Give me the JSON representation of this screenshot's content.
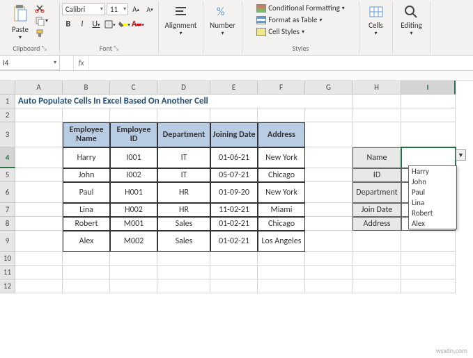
{
  "ribbon": {
    "clipboard": {
      "paste": "Paste",
      "label": "Clipboard"
    },
    "font": {
      "name": "Calibri",
      "size": "11",
      "bold": "B",
      "italic": "I",
      "underline": "U",
      "label": "Font"
    },
    "alignment": {
      "btn": "Alignment",
      "label": "Alignment"
    },
    "number": {
      "btn": "Number",
      "label": "Number"
    },
    "styles": {
      "cond": "Conditional Formatting",
      "table": "Format as Table",
      "cell": "Cell Styles",
      "label": "Styles"
    },
    "cells": {
      "btn": "Cells",
      "label": "Cells"
    },
    "editing": {
      "btn": "Editing",
      "label": "Editing"
    }
  },
  "namebox": "I4",
  "formula": "",
  "columns": [
    "A",
    "B",
    "C",
    "D",
    "E",
    "F",
    "G",
    "H",
    "I"
  ],
  "rows": [
    "1",
    "2",
    "3",
    "4",
    "5",
    "6",
    "7",
    "8",
    "9",
    "10",
    "11",
    "12"
  ],
  "title": "Auto Populate Cells In Excel Based On Another Cell",
  "table": {
    "headers": {
      "name": "Employee Name",
      "id": "Employee ID",
      "dept": "Department",
      "join": "Joining Date",
      "addr": "Address"
    },
    "rows": [
      {
        "name": "Harry",
        "id": "I001",
        "dept": "IT",
        "join": "01-06-21",
        "addr": "New York"
      },
      {
        "name": "John",
        "id": "I002",
        "dept": "IT",
        "join": "05-07-21",
        "addr": "Chicago"
      },
      {
        "name": "Paul",
        "id": "H001",
        "dept": "HR",
        "join": "01-09-20",
        "addr": "New York"
      },
      {
        "name": "Lina",
        "id": "H002",
        "dept": "HR",
        "join": "11-02-21",
        "addr": "Miami"
      },
      {
        "name": "Robert",
        "id": "M001",
        "dept": "Sales",
        "join": "01-02-21",
        "addr": "Chicago"
      },
      {
        "name": "Alex",
        "id": "M002",
        "dept": "Sales",
        "join": "01-02-21",
        "addr": "Los Angeles"
      }
    ]
  },
  "fields": {
    "name": "Name",
    "id": "ID",
    "dept": "Department",
    "join": "Join Date",
    "addr": "Address"
  },
  "dropdown": [
    "Harry",
    "John",
    "Paul",
    "Lina",
    "Robert",
    "Alex"
  ],
  "watermark": "wsxdn.com"
}
